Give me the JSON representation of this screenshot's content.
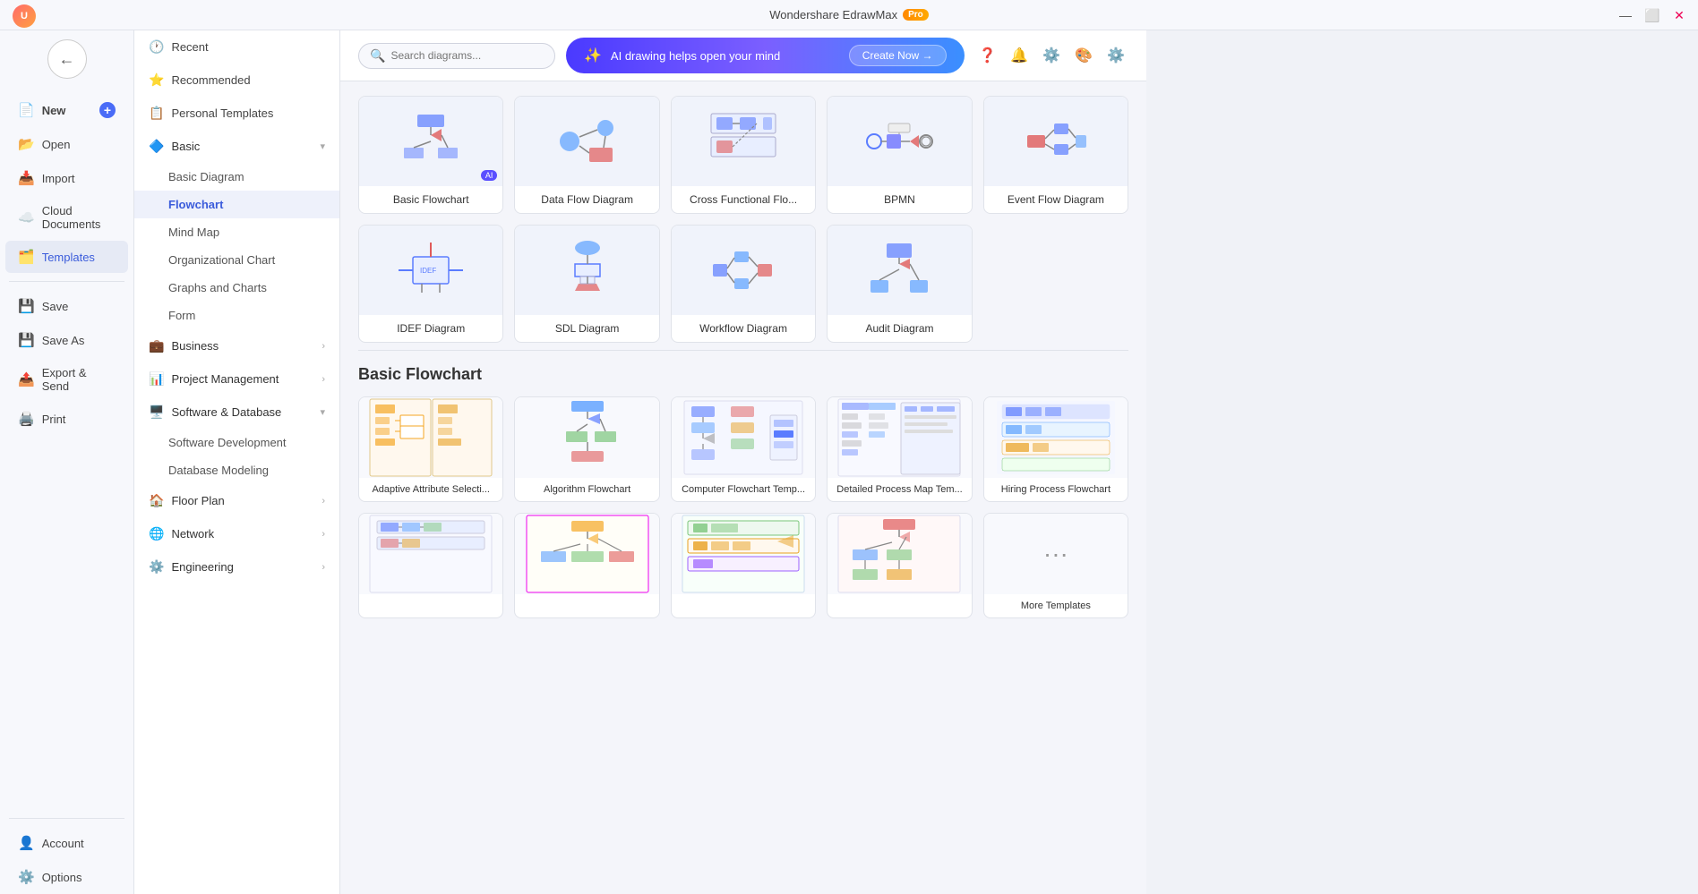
{
  "app": {
    "title": "Wondershare EdrawMax",
    "pro_badge": "Pro",
    "user_initials": "U"
  },
  "win_controls": {
    "minimize": "—",
    "maximize": "⬜",
    "close": "✕"
  },
  "sidebar": {
    "back_label": "←",
    "items": [
      {
        "id": "new",
        "label": "New",
        "icon": "📄"
      },
      {
        "id": "open",
        "label": "Open",
        "icon": "📂"
      },
      {
        "id": "import",
        "label": "Import",
        "icon": "📥"
      },
      {
        "id": "cloud",
        "label": "Cloud Documents",
        "icon": "☁️"
      },
      {
        "id": "templates",
        "label": "Templates",
        "icon": "🗂️",
        "active": true
      },
      {
        "id": "save",
        "label": "Save",
        "icon": "💾"
      },
      {
        "id": "save-as",
        "label": "Save As",
        "icon": "💾"
      },
      {
        "id": "export",
        "label": "Export & Send",
        "icon": "📤"
      },
      {
        "id": "print",
        "label": "Print",
        "icon": "🖨️"
      }
    ],
    "bottom_items": [
      {
        "id": "account",
        "label": "Account",
        "icon": "👤"
      },
      {
        "id": "options",
        "label": "Options",
        "icon": "⚙️"
      }
    ]
  },
  "nav": {
    "top_items": [
      {
        "id": "recent",
        "label": "Recent",
        "icon": "🕐"
      },
      {
        "id": "recommended",
        "label": "Recommended",
        "icon": "⭐"
      },
      {
        "id": "personal",
        "label": "Personal Templates",
        "icon": "📋"
      }
    ],
    "categories": [
      {
        "id": "basic",
        "label": "Basic",
        "icon": "🔷",
        "expanded": true,
        "sub_items": [
          {
            "id": "basic-diagram",
            "label": "Basic Diagram"
          },
          {
            "id": "flowchart",
            "label": "Flowchart",
            "active": true
          },
          {
            "id": "mind-map",
            "label": "Mind Map"
          },
          {
            "id": "org-chart",
            "label": "Organizational Chart"
          },
          {
            "id": "graphs",
            "label": "Graphs and Charts"
          },
          {
            "id": "form",
            "label": "Form"
          }
        ]
      },
      {
        "id": "business",
        "label": "Business",
        "icon": "💼",
        "expanded": false
      },
      {
        "id": "project",
        "label": "Project Management",
        "icon": "📊",
        "expanded": false
      },
      {
        "id": "software",
        "label": "Software & Database",
        "icon": "🖥️",
        "expanded": true,
        "sub_items": [
          {
            "id": "software-dev",
            "label": "Software Development"
          },
          {
            "id": "database",
            "label": "Database Modeling"
          }
        ]
      },
      {
        "id": "floor-plan",
        "label": "Floor Plan",
        "icon": "🏠",
        "expanded": false
      },
      {
        "id": "network",
        "label": "Network",
        "icon": "🌐",
        "expanded": false
      },
      {
        "id": "engineering",
        "label": "Engineering",
        "icon": "⚙️",
        "expanded": false
      }
    ]
  },
  "search": {
    "placeholder": "Search diagrams..."
  },
  "ai_banner": {
    "icon": "✨",
    "text": "AI drawing helps open your mind",
    "button_label": "Create Now →"
  },
  "diagram_types": [
    {
      "id": "basic-flowchart",
      "label": "Basic Flowchart",
      "has_ai": true
    },
    {
      "id": "data-flow",
      "label": "Data Flow Diagram",
      "has_ai": false
    },
    {
      "id": "cross-functional",
      "label": "Cross Functional Flo...",
      "has_ai": false
    },
    {
      "id": "bpmn",
      "label": "BPMN",
      "has_ai": false
    },
    {
      "id": "event-flow",
      "label": "Event Flow Diagram",
      "has_ai": false
    },
    {
      "id": "idef",
      "label": "IDEF Diagram",
      "has_ai": false
    },
    {
      "id": "sdl",
      "label": "SDL Diagram",
      "has_ai": false
    },
    {
      "id": "workflow",
      "label": "Workflow Diagram",
      "has_ai": false
    },
    {
      "id": "audit",
      "label": "Audit Diagram",
      "has_ai": false
    }
  ],
  "basic_flowchart_section": {
    "title": "Basic Flowchart",
    "templates": [
      {
        "id": "adaptive",
        "label": "Adaptive Attribute Selecti..."
      },
      {
        "id": "algorithm",
        "label": "Algorithm Flowchart"
      },
      {
        "id": "computer",
        "label": "Computer Flowchart Temp..."
      },
      {
        "id": "detailed",
        "label": "Detailed Process Map Tem..."
      },
      {
        "id": "hiring",
        "label": "Hiring Process Flowchart"
      },
      {
        "id": "t6",
        "label": ""
      },
      {
        "id": "t7",
        "label": ""
      },
      {
        "id": "t8",
        "label": ""
      },
      {
        "id": "t9",
        "label": ""
      },
      {
        "id": "more",
        "label": "More Templates",
        "is_more": true
      }
    ]
  },
  "topbar_icons": [
    "❓",
    "🔔",
    "⚙️",
    "🎨",
    "⚙️"
  ]
}
